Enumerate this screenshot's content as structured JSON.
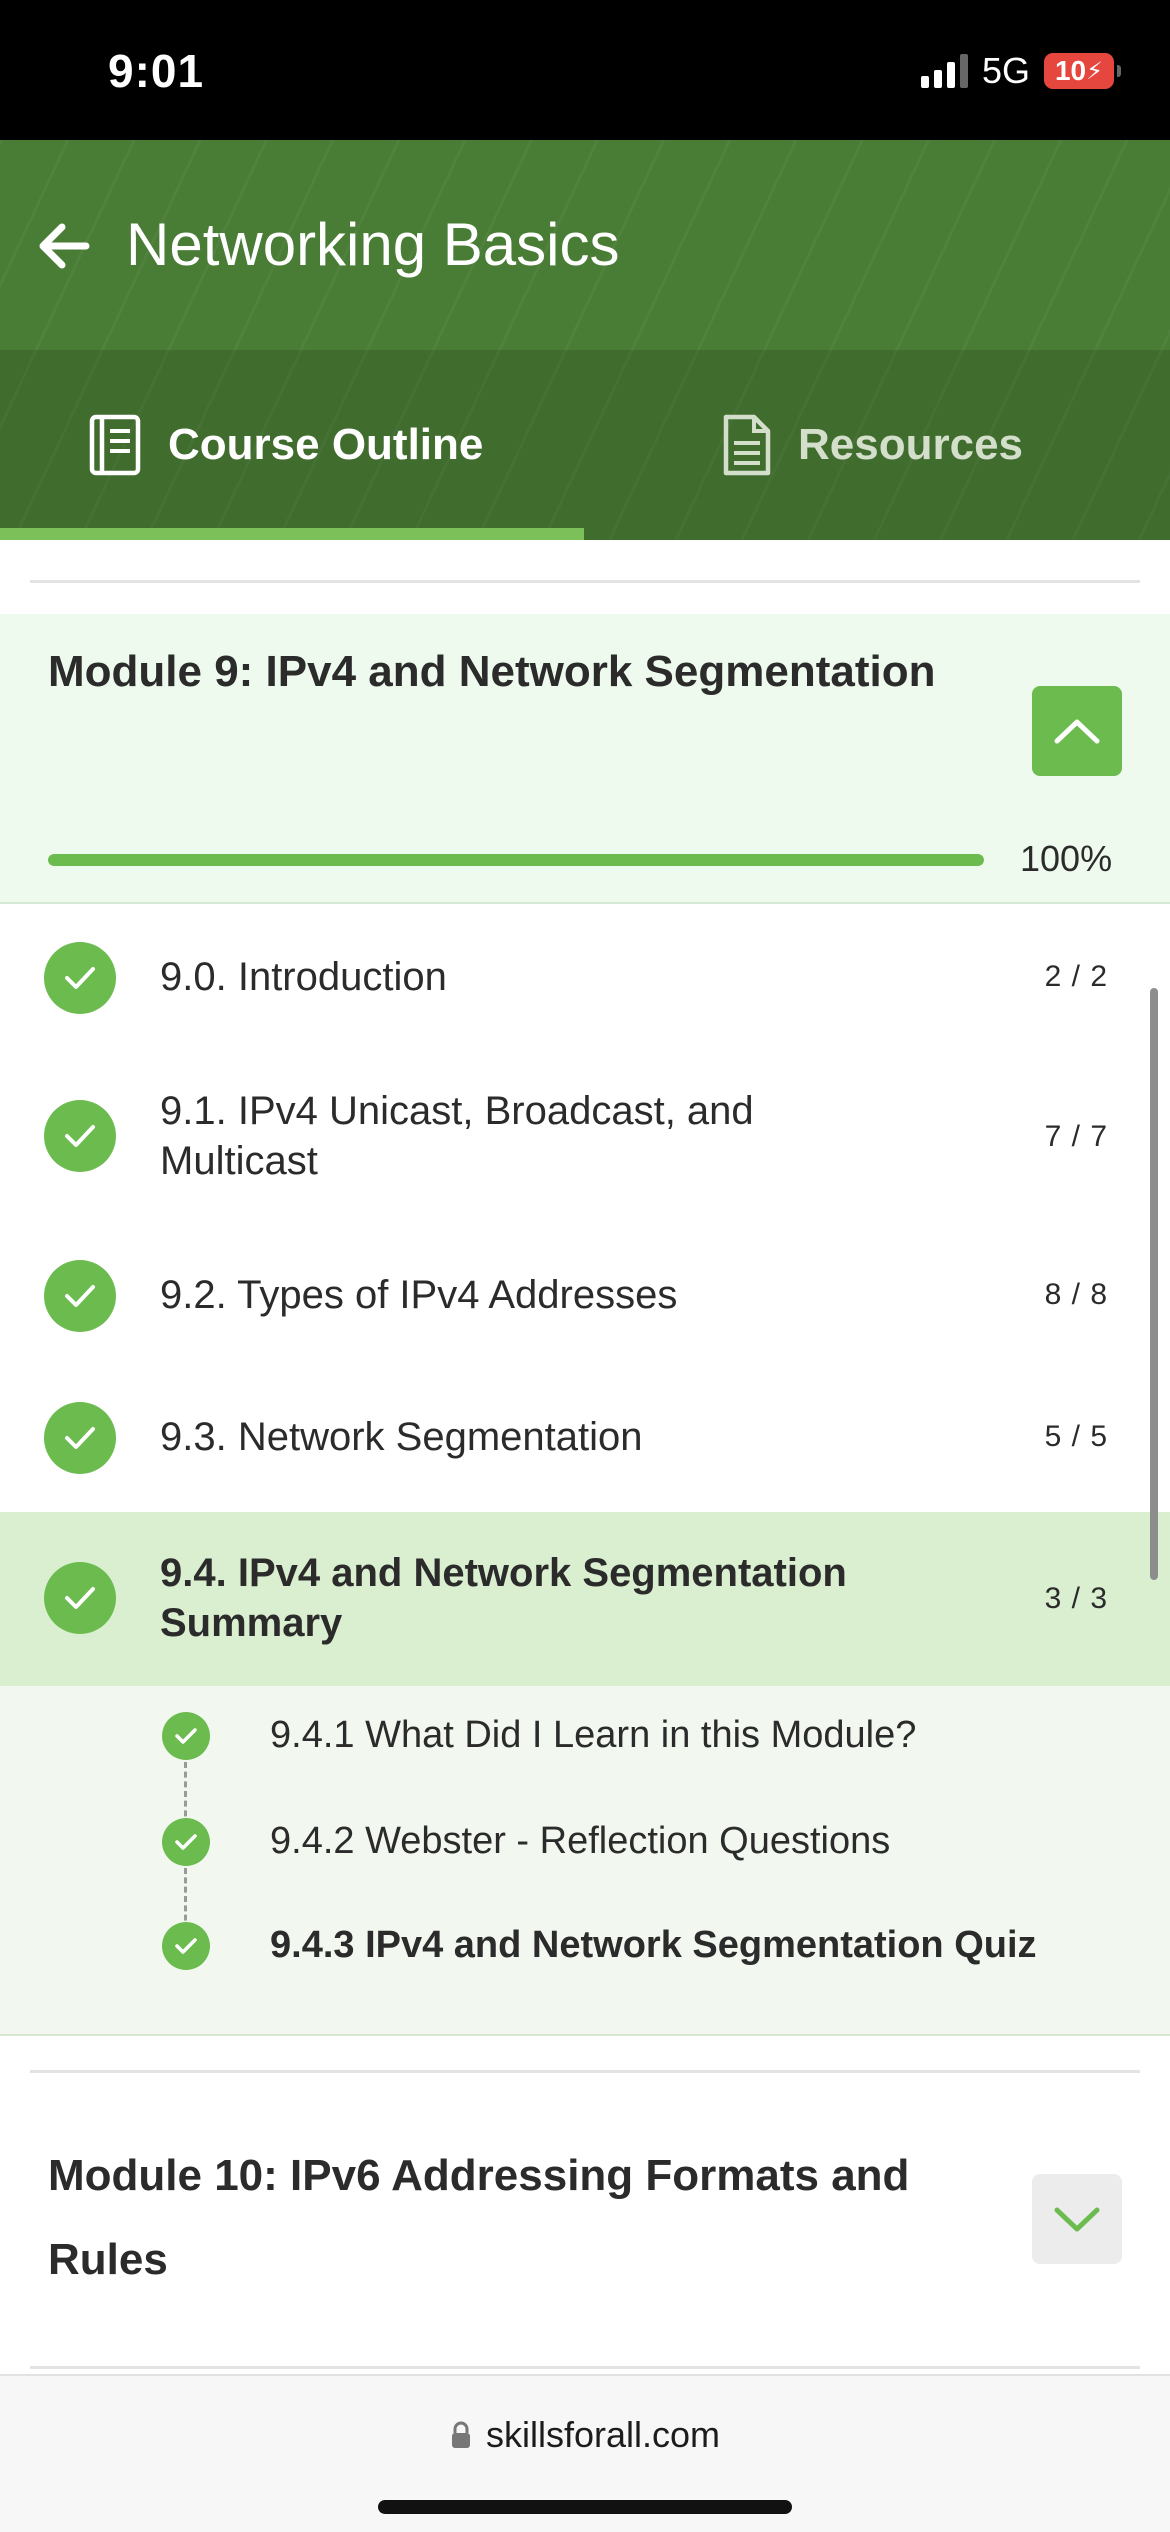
{
  "status": {
    "time": "9:01",
    "network": "5G",
    "battery": "10"
  },
  "header": {
    "title": "Networking Basics"
  },
  "tabs": [
    {
      "label": "Course Outline",
      "icon": "book-icon",
      "active": true
    },
    {
      "label": "Resources",
      "icon": "document-icon",
      "active": false
    }
  ],
  "module9": {
    "title": "Module 9: IPv4 and Network Segmentation",
    "progress": 100,
    "progress_label": "100%",
    "expanded": true,
    "lessons": [
      {
        "label": "9.0. Introduction",
        "count": "2 / 2",
        "done": true
      },
      {
        "label": "9.1. IPv4 Unicast, Broadcast, and Multicast",
        "count": "7 / 7",
        "done": true
      },
      {
        "label": "9.2. Types of IPv4 Addresses",
        "count": "8 / 8",
        "done": true
      },
      {
        "label": "9.3. Network Segmentation",
        "count": "5 / 5",
        "done": true
      },
      {
        "label": "9.4. IPv4 and Network Segmentation Summary",
        "count": "3 / 3",
        "done": true,
        "active": true
      }
    ],
    "sub_items": [
      {
        "label": "9.4.1 What Did I Learn in this Module?",
        "done": true
      },
      {
        "label": "9.4.2 Webster - Reflection Questions",
        "done": true
      },
      {
        "label": "9.4.3 IPv4 and Network Segmentation Quiz",
        "done": true,
        "current": true
      }
    ]
  },
  "module10": {
    "title": "Module 10: IPv6 Addressing Formats and Rules",
    "expanded": false
  },
  "browser": {
    "url": "skillsforall.com"
  },
  "colors": {
    "header_green": "#497c35",
    "accent_green": "#6cbb4f",
    "active_row": "#d9efcf",
    "module_bg": "#eefaee"
  }
}
